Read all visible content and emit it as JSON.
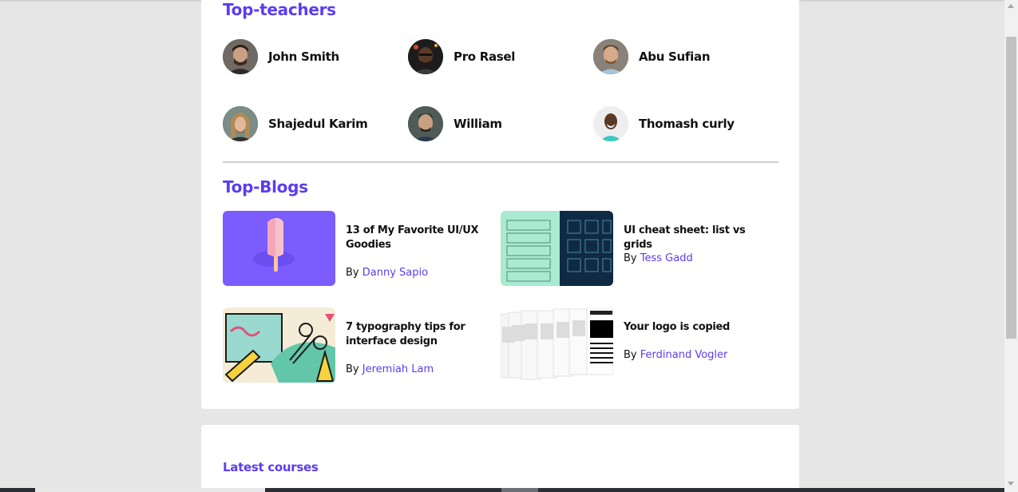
{
  "top_teachers": {
    "title": "Top-teachers",
    "teachers": [
      {
        "name": "John Smith"
      },
      {
        "name": "Pro Rasel"
      },
      {
        "name": "Abu Sufian"
      },
      {
        "name": "Shajedul Karim"
      },
      {
        "name": "William"
      },
      {
        "name": "Thomash curly"
      }
    ]
  },
  "top_blogs": {
    "title": "Top-Blogs",
    "by_label": "By",
    "blogs": [
      {
        "title": "13 of My Favorite UI/UX Goodies",
        "author": "Danny Sapio"
      },
      {
        "title": "UI cheat sheet: list vs grids",
        "author": "Tess Gadd"
      },
      {
        "title": "7 typography tips for interface design",
        "author": "Jeremiah Lam"
      },
      {
        "title": "Your logo is copied",
        "author": "Ferdinand Vogler"
      }
    ]
  },
  "latest_courses": {
    "title": "Latest courses"
  },
  "colors": {
    "accent": "#5a3df0",
    "background": "#e6e6e6",
    "card": "#ffffff"
  }
}
